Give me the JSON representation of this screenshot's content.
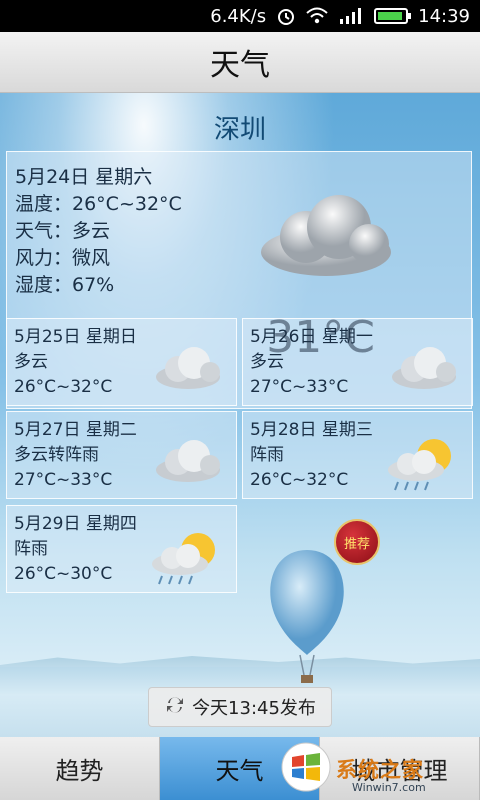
{
  "status_bar": {
    "network_speed": "6.4K/s",
    "time": "14:39"
  },
  "title": "天气",
  "city": "深圳",
  "today": {
    "date": "5月24日 星期六",
    "temperature": "温度：26°C~32°C",
    "weather": "天气：多云",
    "wind": "风力：微风",
    "humidity": "湿度：67%",
    "current_temp": "31°C"
  },
  "forecast": [
    {
      "date": "5月25日 星期日",
      "weather": "多云",
      "temp": "26°C~32°C",
      "icon": "cloudy-icon"
    },
    {
      "date": "5月26日 星期一",
      "weather": "多云",
      "temp": "27°C~33°C",
      "icon": "cloudy-icon"
    },
    {
      "date": "5月27日 星期二",
      "weather": "多云转阵雨",
      "temp": "27°C~33°C",
      "icon": "cloudy-icon"
    },
    {
      "date": "5月28日 星期三",
      "weather": "阵雨",
      "temp": "26°C~32°C",
      "icon": "sun-shower-icon"
    },
    {
      "date": "5月29日 星期四",
      "weather": "阵雨",
      "temp": "26°C~30°C",
      "icon": "sun-shower-icon"
    }
  ],
  "promo": {
    "badge": "推荐"
  },
  "publish": "今天13:45发布",
  "tabs": {
    "trend": "趋势",
    "weather": "天气",
    "city_manage": "城市管理"
  },
  "watermark": {
    "brand": "系统之家",
    "url": "Winwin7.com"
  },
  "colors": {
    "tab_active": "#3c8fd2",
    "title_bar": "#e6e6e6"
  }
}
